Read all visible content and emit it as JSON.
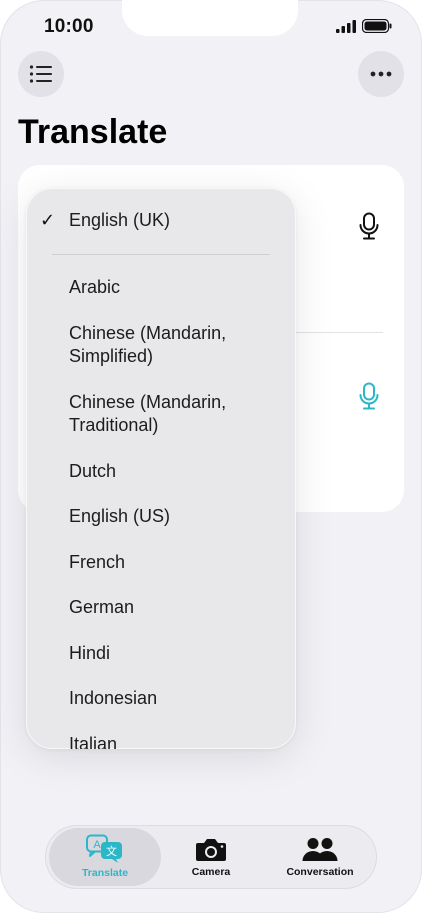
{
  "status_bar": {
    "time": "10:00"
  },
  "header": {
    "title": "Translate"
  },
  "language_menu": {
    "selected": "English (UK)",
    "items": [
      "Arabic",
      "Chinese (Mandarin, Simplified)",
      "Chinese (Mandarin, Traditional)",
      "Dutch",
      "English (US)",
      "French",
      "German",
      "Hindi",
      "Indonesian",
      "Italian"
    ]
  },
  "tab_bar": {
    "tabs": [
      {
        "label": "Translate",
        "active": true,
        "icon": "translate-icon"
      },
      {
        "label": "Camera",
        "active": false,
        "icon": "camera-icon"
      },
      {
        "label": "Conversation",
        "active": false,
        "icon": "people-icon"
      }
    ]
  },
  "colors": {
    "accent": "#2bb7c8",
    "background": "#f2f1f6",
    "card": "#ffffff",
    "menu": "#e8e8ea"
  }
}
